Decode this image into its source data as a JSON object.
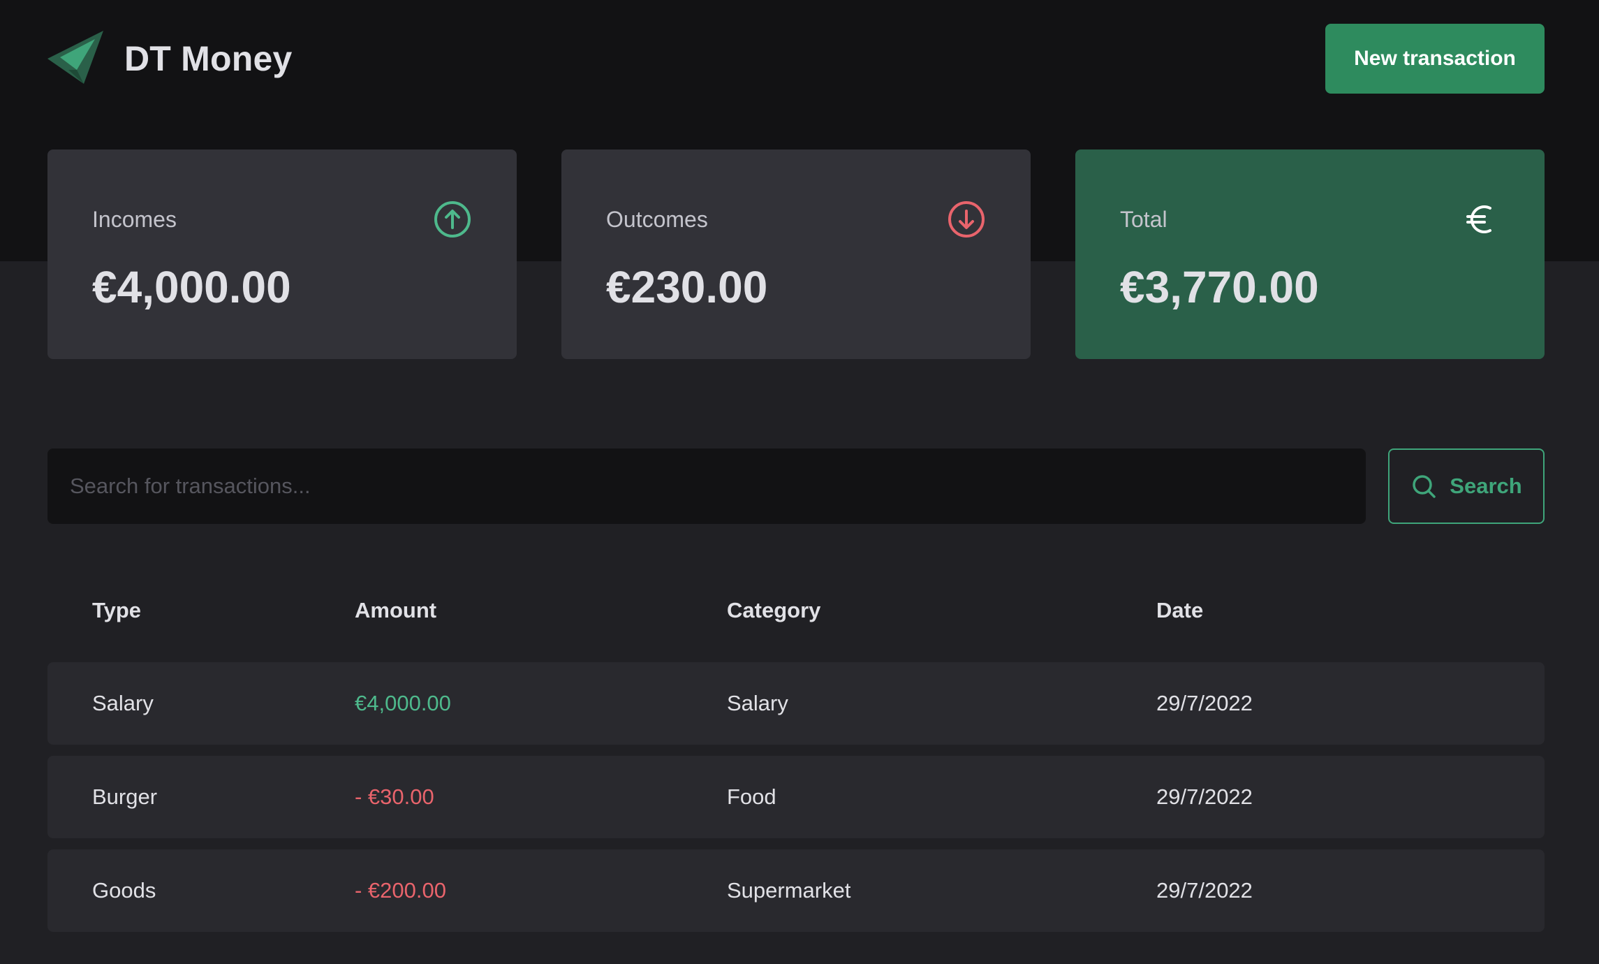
{
  "app": {
    "title": "DT Money",
    "logo_icon": "dt-money-logo-icon"
  },
  "header": {
    "new_transaction_label": "New transaction"
  },
  "colors": {
    "brand_green": "#2E8B5E",
    "total_card": "#2A6049",
    "income": "#4EB98C",
    "outcome": "#E9646C",
    "background": "#202024",
    "header_background": "#121214"
  },
  "summary": {
    "incomes": {
      "label": "Incomes",
      "value": "€4,000.00",
      "icon": "arrow-circle-up-icon"
    },
    "outcomes": {
      "label": "Outcomes",
      "value": "€230.00",
      "icon": "arrow-circle-down-icon"
    },
    "total": {
      "label": "Total",
      "value": "€3,770.00",
      "icon": "euro-icon"
    }
  },
  "search": {
    "placeholder": "Search for transactions...",
    "value": "",
    "button_label": "Search",
    "icon": "search-icon"
  },
  "table": {
    "headers": {
      "type": "Type",
      "amount": "Amount",
      "category": "Category",
      "date": "Date"
    },
    "rows": [
      {
        "type": "Salary",
        "amount": "€4,000.00",
        "kind": "income",
        "category": "Salary",
        "date": "29/7/2022"
      },
      {
        "type": "Burger",
        "amount": "- €30.00",
        "kind": "outcome",
        "category": "Food",
        "date": "29/7/2022"
      },
      {
        "type": "Goods",
        "amount": "- €200.00",
        "kind": "outcome",
        "category": "Supermarket",
        "date": "29/7/2022"
      }
    ]
  }
}
